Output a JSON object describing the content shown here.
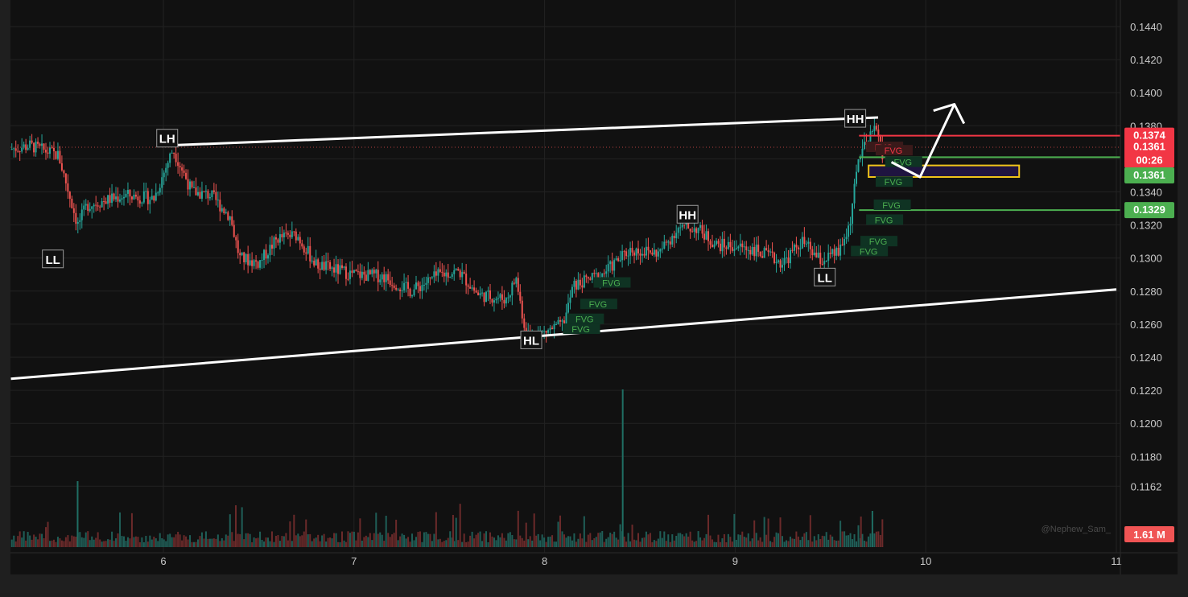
{
  "chart_data": {
    "type": "candlestick",
    "title": "",
    "xlabel": "",
    "ylabel": "",
    "x_ticks": [
      "6",
      "7",
      "8",
      "9",
      "10",
      "11"
    ],
    "y_ticks": [
      "0.1162",
      "0.1180",
      "0.1200",
      "0.1220",
      "0.1240",
      "0.1260",
      "0.1280",
      "0.1300",
      "0.1320",
      "0.1340",
      "0.1360",
      "0.1380",
      "0.1400",
      "0.1420",
      "0.1440"
    ],
    "ylim": [
      0.1152,
      0.1454
    ],
    "xlim": [
      5.2,
      11.0
    ],
    "grid": true,
    "price_labels": {
      "upper_level": "0.1374",
      "current_price": "0.1361",
      "countdown": "00:26",
      "middle_level": "0.1361",
      "lower_level": "0.1329",
      "volume": "1.61 M"
    },
    "levels": [
      {
        "name": "upper_level",
        "y": 0.1374,
        "color": "#f23645"
      },
      {
        "name": "middle_level",
        "y": 0.1361,
        "color": "#4caf50"
      },
      {
        "name": "lower_level",
        "y": 0.1329,
        "color": "#4caf50"
      }
    ],
    "swing_labels": [
      {
        "text": "LH",
        "x": 6.02,
        "y": 0.1372
      },
      {
        "text": "LL",
        "x": 5.42,
        "y": 0.1299
      },
      {
        "text": "HL",
        "x": 7.93,
        "y": 0.125
      },
      {
        "text": "HH",
        "x": 8.75,
        "y": 0.1326
      },
      {
        "text": "LL",
        "x": 9.47,
        "y": 0.1288
      },
      {
        "text": "HH",
        "x": 9.63,
        "y": 0.1384
      }
    ],
    "fvg_labels": [
      {
        "text": "FVG",
        "x": 8.35,
        "y": 0.1285,
        "color": "#4caf50"
      },
      {
        "text": "FVG",
        "x": 8.28,
        "y": 0.1272,
        "color": "#4caf50"
      },
      {
        "text": "FVG",
        "x": 8.21,
        "y": 0.1263,
        "color": "#4caf50"
      },
      {
        "text": "FVG",
        "x": 8.19,
        "y": 0.1257,
        "color": "#4caf50"
      },
      {
        "text": "FVG",
        "x": 9.78,
        "y": 0.1367,
        "color": "#f23645"
      },
      {
        "text": "FVG",
        "x": 9.83,
        "y": 0.1365,
        "color": "#f23645"
      },
      {
        "text": "FVG",
        "x": 9.88,
        "y": 0.1358,
        "color": "#4caf50"
      },
      {
        "text": "FVG",
        "x": 9.83,
        "y": 0.1346,
        "color": "#4caf50"
      },
      {
        "text": "FVG",
        "x": 9.82,
        "y": 0.1332,
        "color": "#4caf50"
      },
      {
        "text": "FVG",
        "x": 9.78,
        "y": 0.1323,
        "color": "#4caf50"
      },
      {
        "text": "FVG",
        "x": 9.75,
        "y": 0.131,
        "color": "#4caf50"
      },
      {
        "text": "FVG",
        "x": 9.7,
        "y": 0.1304,
        "color": "#4caf50"
      }
    ],
    "trendlines": [
      {
        "name": "upper-trendline",
        "points": [
          [
            6.0,
            0.1368
          ],
          [
            9.75,
            0.1385
          ]
        ]
      },
      {
        "name": "lower-trendline",
        "points": [
          [
            5.2,
            0.1227
          ],
          [
            11.0,
            0.1281
          ]
        ]
      }
    ],
    "zone": {
      "x1": 9.7,
      "x2": 10.49,
      "y1": 0.1349,
      "y2": 0.1356,
      "color": "#f0c419"
    },
    "projection": [
      [
        9.82,
        0.1358
      ],
      [
        9.97,
        0.1349
      ],
      [
        10.15,
        0.1393
      ]
    ],
    "watermark": "@Nephew_Sam_",
    "colors": {
      "up": "#26a69a",
      "down": "#ef5350",
      "background": "#111111",
      "grid": "#222222"
    }
  }
}
